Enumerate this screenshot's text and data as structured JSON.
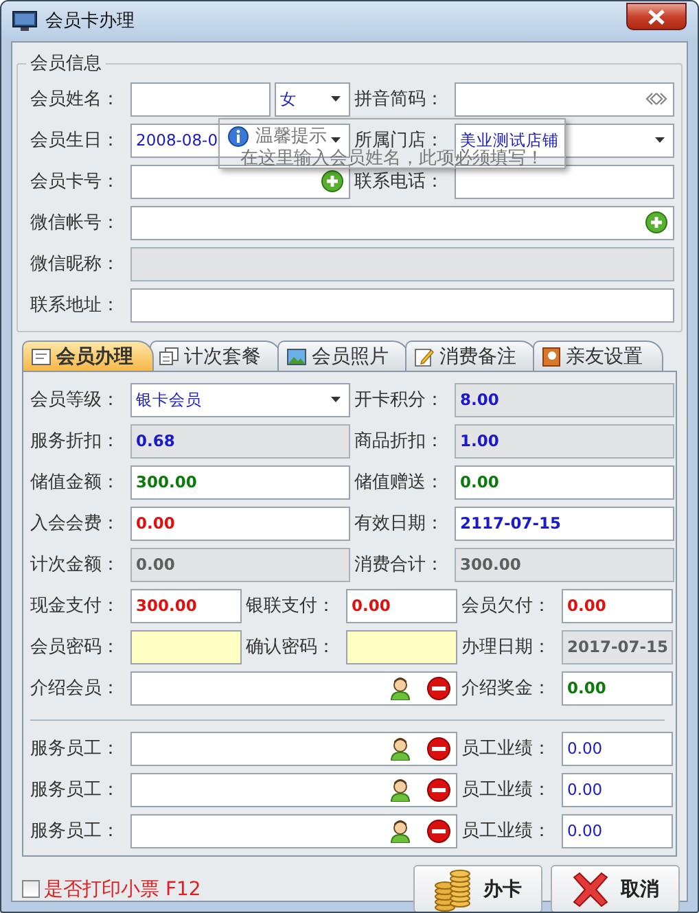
{
  "window": {
    "title": "会员卡办理"
  },
  "member_info": {
    "legend": "会员信息",
    "rows": [
      {
        "kind": "pair",
        "cells": [
          {
            "label": "会员姓名：",
            "fields": [
              {
                "kind": "input"
              },
              {
                "kind": "select",
                "value": "女",
                "color": "#1a1acc",
                "bold": false
              }
            ]
          },
          {
            "label": "拼音简码：",
            "fields": [
              {
                "kind": "pinyin"
              }
            ]
          }
        ]
      },
      {
        "kind": "pair",
        "cells": [
          {
            "label": "会员生日：",
            "fields": [
              {
                "kind": "date",
                "value": "2008-08-0",
                "color": "#1a1acc",
                "bold": false
              }
            ]
          },
          {
            "label": "所属门店：",
            "fields": [
              {
                "kind": "select",
                "value": "美业测试店铺",
                "color": "#1a1acc",
                "bold": false
              }
            ]
          }
        ]
      },
      {
        "kind": "pair",
        "cells": [
          {
            "label": "会员卡号：",
            "fields": [
              {
                "kind": "add"
              }
            ]
          },
          {
            "label": "联系电话：",
            "fields": [
              {
                "kind": "input"
              }
            ]
          }
        ]
      },
      {
        "kind": "full",
        "cells": [
          {
            "label": "微信帐号：",
            "fields": [
              {
                "kind": "add"
              }
            ]
          }
        ]
      },
      {
        "kind": "full",
        "cells": [
          {
            "label": "微信昵称：",
            "fields": [
              {
                "kind": "readonly"
              }
            ]
          }
        ]
      },
      {
        "kind": "full",
        "cells": [
          {
            "label": "联系地址：",
            "fields": [
              {
                "kind": "input"
              }
            ]
          }
        ]
      }
    ]
  },
  "tooltip": {
    "title": "温馨提示",
    "message": "在这里输入会员姓名，此项必须填写！"
  },
  "tabs": [
    {
      "label": "会员办理",
      "selected": true
    },
    {
      "label": "计次套餐",
      "selected": false
    },
    {
      "label": "会员照片",
      "selected": false
    },
    {
      "label": "消费备注",
      "selected": false
    },
    {
      "label": "亲友设置",
      "selected": false
    }
  ],
  "panel": {
    "rows": [
      {
        "kind": "pair",
        "cells": [
          {
            "label": "会员等级：",
            "fields": [
              {
                "kind": "select",
                "value": "银卡会员",
                "color": "#1a1acc",
                "bold": false
              }
            ]
          },
          {
            "label": "开卡积分：",
            "fields": [
              {
                "kind": "readonly",
                "value": "8.00",
                "color": "#1a1acc",
                "bold": true
              }
            ]
          }
        ]
      },
      {
        "kind": "pair",
        "cells": [
          {
            "label": "服务折扣：",
            "fields": [
              {
                "kind": "readonly",
                "value": "0.68",
                "color": "#1a1acc",
                "bold": true
              }
            ]
          },
          {
            "label": "商品折扣：",
            "fields": [
              {
                "kind": "readonly",
                "value": "1.00",
                "color": "#1a1acc",
                "bold": true
              }
            ]
          }
        ]
      },
      {
        "kind": "pair",
        "cells": [
          {
            "label": "储值金额：",
            "fields": [
              {
                "kind": "input",
                "value": "300.00",
                "color": "#0a7a0a",
                "bold": true
              }
            ]
          },
          {
            "label": "储值赠送：",
            "fields": [
              {
                "kind": "input",
                "value": "0.00",
                "color": "#0a7a0a",
                "bold": true
              }
            ]
          }
        ]
      },
      {
        "kind": "pair",
        "cells": [
          {
            "label": "入会会费：",
            "fields": [
              {
                "kind": "input",
                "value": "0.00",
                "color": "#e01010",
                "bold": true
              }
            ]
          },
          {
            "label": "有效日期：",
            "fields": [
              {
                "kind": "input",
                "value": "2117-07-15",
                "color": "#1a1acc",
                "bold": true
              }
            ]
          }
        ]
      },
      {
        "kind": "pair",
        "cells": [
          {
            "label": "计次金额：",
            "fields": [
              {
                "kind": "readonly",
                "value": "0.00",
                "color": "#5e5e5e",
                "bold": true
              }
            ]
          },
          {
            "label": "消费合计：",
            "fields": [
              {
                "kind": "readonly",
                "value": "300.00",
                "color": "#5e5e5e",
                "bold": true
              }
            ]
          }
        ]
      },
      {
        "kind": "triple",
        "cells": [
          {
            "label": "现金支付：",
            "fields": [
              {
                "kind": "input",
                "value": "300.00",
                "color": "#e01010",
                "bold": true
              }
            ]
          },
          {
            "label": "银联支付：",
            "fields": [
              {
                "kind": "input",
                "value": "0.00",
                "color": "#e01010",
                "bold": true
              }
            ]
          },
          {
            "label": "会员欠付：",
            "fields": [
              {
                "kind": "input",
                "value": "0.00",
                "color": "#e01010",
                "bold": true
              }
            ]
          }
        ]
      },
      {
        "kind": "triple",
        "cells": [
          {
            "label": "会员密码：",
            "fields": [
              {
                "kind": "password"
              }
            ]
          },
          {
            "label": "确认密码：",
            "fields": [
              {
                "kind": "password"
              }
            ]
          },
          {
            "label": "办理日期：",
            "fields": [
              {
                "kind": "readonly",
                "value": "2017-07-15",
                "color": "#5e5e5e",
                "bold": true
              }
            ]
          }
        ]
      },
      {
        "kind": "person",
        "cells": [
          {
            "label": "介绍会员：",
            "fields": [
              {
                "kind": "person"
              }
            ]
          },
          {
            "label": "介绍奖金：",
            "fields": [
              {
                "kind": "input",
                "value": "0.00",
                "color": "#0a7a0a",
                "bold": true
              }
            ]
          }
        ]
      },
      {
        "kind": "divider"
      },
      {
        "kind": "person",
        "cells": [
          {
            "label": "服务员工：",
            "fields": [
              {
                "kind": "person"
              }
            ]
          },
          {
            "label": "员工业绩：",
            "fields": [
              {
                "kind": "input",
                "value": "0.00",
                "color": "#1a1acc",
                "bold": false
              }
            ]
          }
        ]
      },
      {
        "kind": "person",
        "cells": [
          {
            "label": "服务员工：",
            "fields": [
              {
                "kind": "person"
              }
            ]
          },
          {
            "label": "员工业绩：",
            "fields": [
              {
                "kind": "input",
                "value": "0.00",
                "color": "#1a1acc",
                "bold": false
              }
            ]
          }
        ]
      },
      {
        "kind": "person",
        "cells": [
          {
            "label": "服务员工：",
            "fields": [
              {
                "kind": "person"
              }
            ]
          },
          {
            "label": "员工业绩：",
            "fields": [
              {
                "kind": "input",
                "value": "0.00",
                "color": "#1a1acc",
                "bold": false
              }
            ]
          }
        ]
      }
    ]
  },
  "footer": {
    "print_receipt": {
      "label": "是否打印小票 F12",
      "checked": false
    },
    "buttons": [
      {
        "label": "办卡",
        "kind": "coins"
      },
      {
        "label": "取消",
        "kind": "cancel"
      }
    ]
  }
}
